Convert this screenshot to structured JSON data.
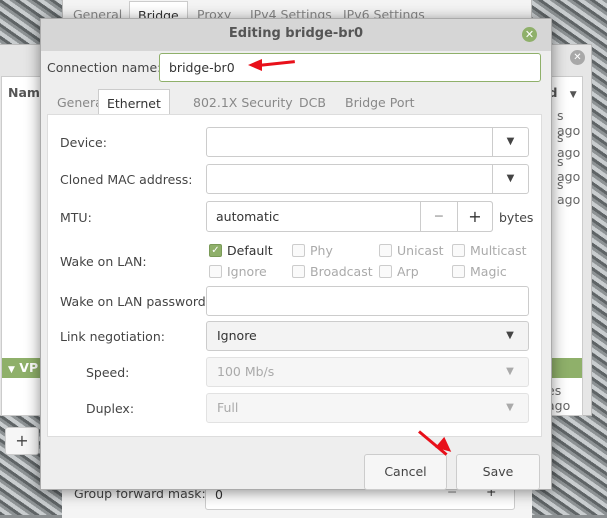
{
  "background_window_top": {
    "tabs": [
      "General",
      "Bridge",
      "Proxy",
      "IPv4 Settings",
      "IPv6 Settings"
    ],
    "active_tab": "Bridge"
  },
  "background_window_list": {
    "column_name": "Name",
    "column_last_used": "ed",
    "rows_right": [
      "s ago",
      "s ago",
      "s ago",
      "s ago"
    ],
    "group_label": "VP",
    "group_row_right": "es ago",
    "add_label": "+"
  },
  "background_window_bottom": {
    "label": "Group forward mask:",
    "value": "0",
    "minus": "−",
    "plus": "+"
  },
  "dialog": {
    "title": "Editing bridge-br0",
    "close_icon": "close-icon",
    "connection_name_label": "Connection name:",
    "connection_name_value": "bridge-br0",
    "tabs": [
      "General",
      "Ethernet",
      "802.1X Security",
      "DCB",
      "Bridge Port"
    ],
    "active_tab": "Ethernet",
    "device_label": "Device:",
    "device_value": "",
    "cloned_mac_label": "Cloned MAC address:",
    "cloned_mac_value": "",
    "mtu_label": "MTU:",
    "mtu_value": "automatic",
    "mtu_minus": "−",
    "mtu_plus": "+",
    "mtu_unit": "bytes",
    "wol_label": "Wake on LAN:",
    "wol_options": [
      {
        "label": "Default",
        "checked": true
      },
      {
        "label": "Phy",
        "checked": false
      },
      {
        "label": "Unicast",
        "checked": false
      },
      {
        "label": "Multicast",
        "checked": false
      },
      {
        "label": "Ignore",
        "checked": false
      },
      {
        "label": "Broadcast",
        "checked": false
      },
      {
        "label": "Arp",
        "checked": false
      },
      {
        "label": "Magic",
        "checked": false
      }
    ],
    "wol_password_label": "Wake on LAN password:",
    "wol_password_value": "",
    "link_negotiation_label": "Link negotiation:",
    "link_negotiation_value": "Ignore",
    "speed_label": "Speed:",
    "speed_value": "100 Mb/s",
    "duplex_label": "Duplex:",
    "duplex_value": "Full",
    "cancel_label": "Cancel",
    "save_label": "Save"
  },
  "colors": {
    "accent": "#8fb06a",
    "annotation_arrow": "#e8101a"
  }
}
